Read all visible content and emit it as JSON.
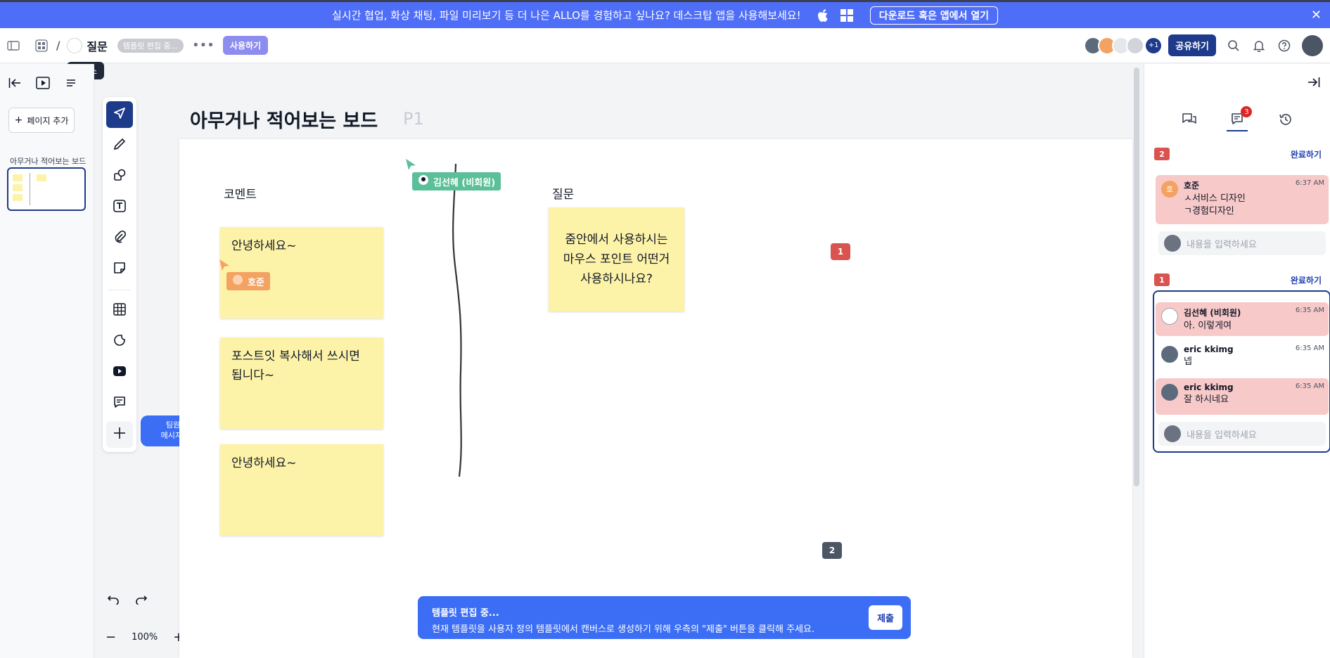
{
  "banner": {
    "message": "실시간 협업, 화상 채팅, 파일 미리보기 등 더 나은 ALLO를 경험하고 싶나요? 데스크탑 앱을 사용해보세요!",
    "download_label": "다운로드 혹은 앱에서 열기",
    "close_label": "✕"
  },
  "header": {
    "breadcrumb_sep": "/",
    "title": "질문",
    "status_pill": "템플릿 편집 중...",
    "more_label": "•••",
    "use_label": "사용하기",
    "tooltip": "캔버스",
    "extra_count": "+1",
    "share_label": "공유하기"
  },
  "left_panel": {
    "add_page_label": "페이지 추가",
    "page_name": "아무거나 적어보는 보드"
  },
  "toolbar": {
    "audio_tip_line1": "팀원들과 오디오 메모로",
    "audio_tip_line2": "메시지를 주고받아 보세요!",
    "zoom_label": "100%"
  },
  "board": {
    "title": "아무거나 적어보는 보드",
    "page_tag": "P1",
    "col_comment": "코멘트",
    "col_question": "질문",
    "stickies": [
      {
        "text": "안녕하세요~"
      },
      {
        "text": "포스트잇 복사해서 쓰시면 됩니다~"
      },
      {
        "text": "안녕하세요~"
      },
      {
        "text": "줌안에서 사용하시는 마우스 포인트 어떤거 사용하시나요?"
      }
    ],
    "cursors": [
      {
        "name": "김선혜 (비회원)",
        "color": "#5bbf9a"
      },
      {
        "name": "호준",
        "color": "#f4a261"
      }
    ],
    "badge_red": "1",
    "badge_gray": "2"
  },
  "template_bar": {
    "title": "템플릿 편집 중...",
    "desc": "현재 템플릿을 사용자 정의 템플릿에서 캔버스로 생성하기 위해 우측의 \"제출\" 버튼을 클릭해 주세요.",
    "submit_label": "제출"
  },
  "right_panel": {
    "tab_badge": "3",
    "thread1": {
      "num": "2",
      "done_label": "완료하기",
      "comments": [
        {
          "name": "호준",
          "time": "6:37 AM",
          "text1": "ㅅ서비스 디자인",
          "text2": "ㄱ경험디자인",
          "avatar_letter": "호"
        }
      ],
      "reply_placeholder": "내용을 입력하세요"
    },
    "thread2": {
      "num": "1",
      "done_label": "완료하기",
      "comments": [
        {
          "name": "김선혜 (비회원)",
          "time": "6:35 AM",
          "text": "아. 이렇게여"
        },
        {
          "name": "eric kkimg",
          "time": "6:35 AM",
          "text": "넵"
        },
        {
          "name": "eric kkimg",
          "time": "6:35 AM",
          "text": "잘 하시네요"
        }
      ],
      "reply_placeholder": "내용을 입력하세요"
    }
  },
  "colors": {
    "banner": "#4f6ef7",
    "primary": "#1e3a8a",
    "sticky": "#fdf3a8",
    "comment_highlight": "#f8c9c9",
    "badge_red": "#d9534f"
  }
}
